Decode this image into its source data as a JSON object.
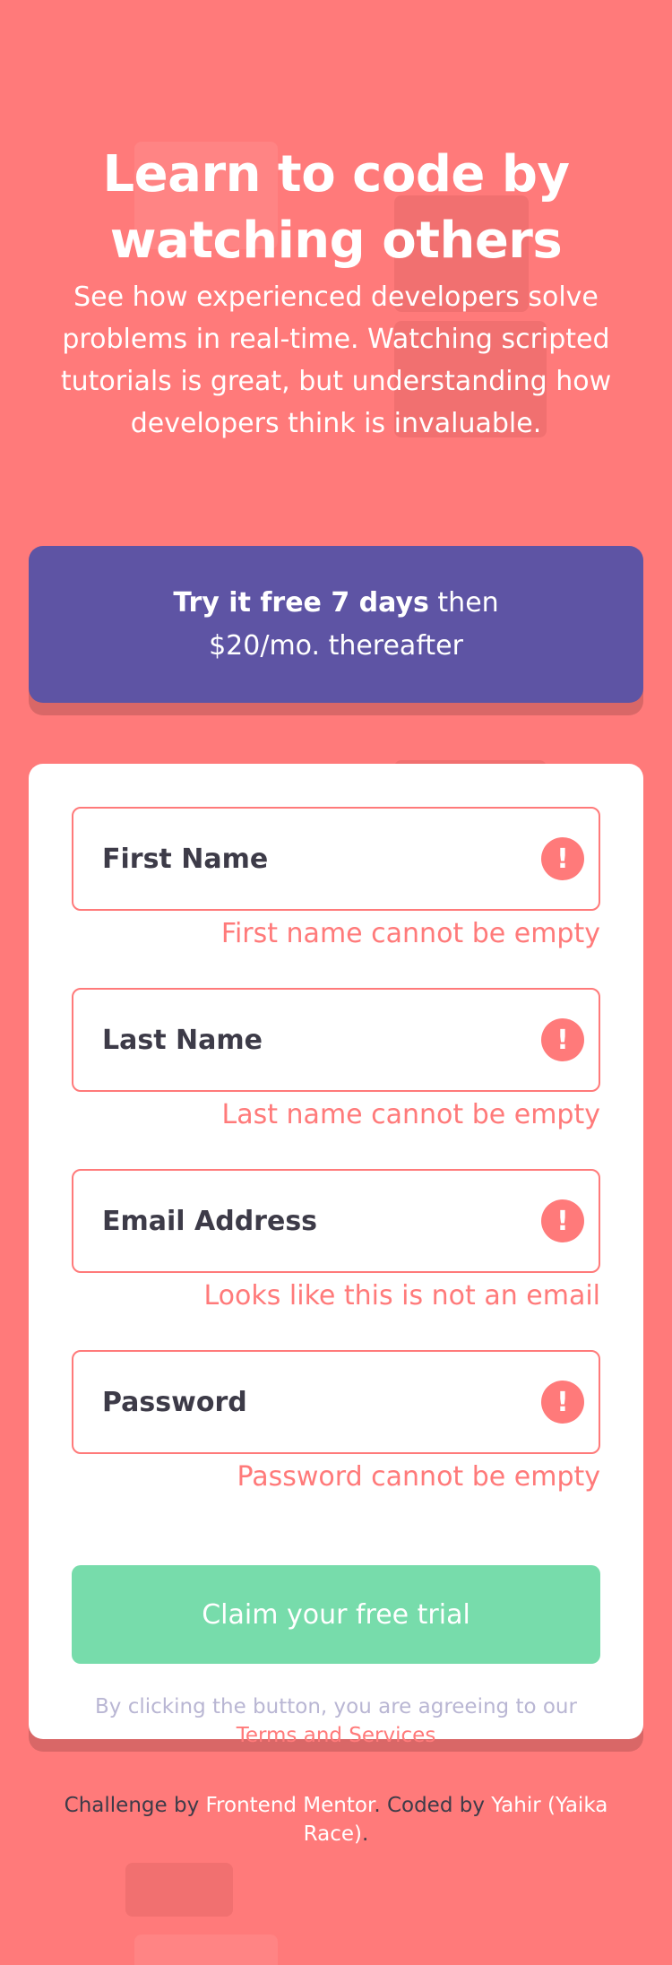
{
  "hero": {
    "title": "Learn to code by watching others",
    "text": "See how experienced developers solve problems in real-time. Watching scripted tutorials is great, but understanding how developers think is invaluable."
  },
  "promo": {
    "bold": "Try it free 7 days",
    "text_1": " then",
    "text_2": "$20/mo. thereafter"
  },
  "form": {
    "fields": [
      {
        "placeholder": "First Name",
        "value": "",
        "error": "First name cannot be empty",
        "icon": "error-icon"
      },
      {
        "placeholder": "Last Name",
        "value": "",
        "error": "Last name cannot be empty",
        "icon": "error-icon"
      },
      {
        "placeholder": "Email Address",
        "value": "",
        "error": "Looks like this is not an email",
        "icon": "error-icon"
      },
      {
        "placeholder": "Password",
        "value": "",
        "error": "Password cannot be empty",
        "icon": "error-icon"
      }
    ],
    "error_icon_glyph": "!",
    "submit_label": "Claim your free trial",
    "terms_text": "By clicking the button, you are agreeing to our",
    "terms_link": "Terms and Services"
  },
  "footer": {
    "prefix": "Challenge by ",
    "link_1": "Frontend Mentor",
    "middle": ". Coded by ",
    "link_2": "Yahir (Yaika Race)",
    "suffix": "."
  },
  "colors": {
    "background": "#ff7a7a",
    "promo": "#5e54a4",
    "submit": "#77dcab",
    "error": "#ff7a7a",
    "text_dark": "#3d3b48",
    "muted": "#b9b6d3"
  }
}
